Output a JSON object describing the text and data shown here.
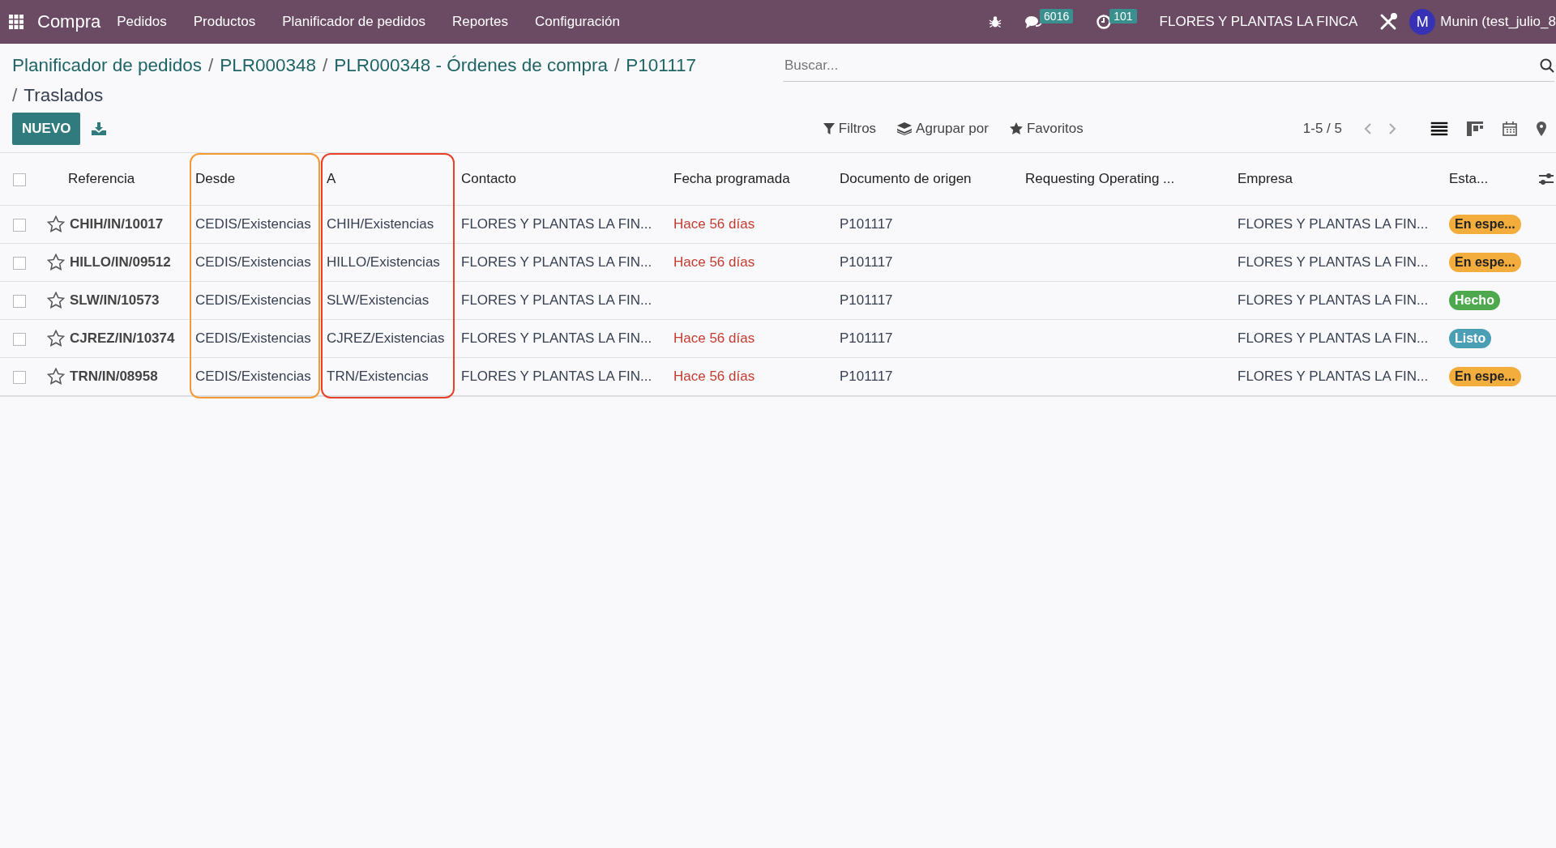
{
  "navbar": {
    "brand": "Compra",
    "menus": [
      "Pedidos",
      "Productos",
      "Planificador de pedidos",
      "Reportes",
      "Configuración"
    ],
    "messages_count": "6016",
    "activities_count": "101",
    "company": "FLORES Y PLANTAS LA FINCA",
    "avatar_letter": "M",
    "user": "Munin (test_julio_8"
  },
  "breadcrumbs": [
    {
      "label": "Planificador de pedidos"
    },
    {
      "separator": "/",
      "label": "PLR000348"
    },
    {
      "separator": "/",
      "label": "PLR000348 - Órdenes de compra"
    },
    {
      "separator": "/",
      "label": "P101117"
    },
    {
      "separator": "/",
      "label": "Traslados"
    }
  ],
  "search": {
    "placeholder": "Buscar..."
  },
  "buttons": {
    "new": "NUEVO"
  },
  "filters": [
    "Filtros",
    "Agrupar por",
    "Favoritos"
  ],
  "pager": "1-5 / 5",
  "views": [
    {
      "kind": "list",
      "selected": true
    },
    {
      "kind": "kanban",
      "selected": false
    },
    {
      "kind": "calendar",
      "selected": false
    },
    {
      "kind": "map",
      "selected": false
    }
  ],
  "table": {
    "select_all": {
      "checked": false
    },
    "columns": [
      {
        "label": "Referencia"
      },
      {
        "label": "Desde",
        "color": "#f39a35"
      },
      {
        "label": "A",
        "color": "#e8402a"
      },
      {
        "label": "Contacto"
      },
      {
        "label": "Fecha programada"
      },
      {
        "label": "Documento de origen"
      },
      {
        "label": "Requesting Operating ..."
      },
      {
        "label": "Empresa"
      },
      {
        "label": "Esta..."
      }
    ],
    "rows": [
      {
        "checked": false,
        "starred": false,
        "reference": "CHIH/IN/10017",
        "from": "CEDIS/Existencias",
        "to": "CHIH/Existencias",
        "contact": "FLORES Y PLANTAS LA FIN...",
        "scheduled_date": "Hace 56 días",
        "source_document": "P101117",
        "company": "FLORES Y PLANTAS LA FIN...",
        "status": {
          "label": "En espe...",
          "color": "#f3ad3d"
        }
      },
      {
        "checked": false,
        "starred": false,
        "reference": "HILLO/IN/09512",
        "from": "CEDIS/Existencias",
        "to": "HILLO/Existencias",
        "contact": "FLORES Y PLANTAS LA FIN...",
        "scheduled_date": "Hace 56 días",
        "source_document": "P101117",
        "company": "FLORES Y PLANTAS LA FIN...",
        "status": {
          "label": "En espe...",
          "color": "#f3ad3d"
        }
      },
      {
        "checked": false,
        "starred": false,
        "reference": "SLW/IN/10573",
        "from": "CEDIS/Existencias",
        "to": "SLW/Existencias",
        "contact": "FLORES Y PLANTAS LA FIN...",
        "source_document": "P101117",
        "company": "FLORES Y PLANTAS LA FIN...",
        "status": {
          "label": "Hecho",
          "color": "#4ea84e"
        }
      },
      {
        "checked": false,
        "starred": false,
        "reference": "CJREZ/IN/10374",
        "from": "CEDIS/Existencias",
        "to": "CJREZ/Existencias",
        "contact": "FLORES Y PLANTAS LA FIN...",
        "scheduled_date": "Hace 56 días",
        "source_document": "P101117",
        "company": "FLORES Y PLANTAS LA FIN...",
        "status": {
          "label": "Listo",
          "color": "#4a9fb5"
        }
      },
      {
        "checked": false,
        "starred": false,
        "reference": "TRN/IN/08958",
        "from": "CEDIS/Existencias",
        "to": "TRN/Existencias",
        "contact": "FLORES Y PLANTAS LA FIN...",
        "scheduled_date": "Hace 56 días",
        "source_document": "P101117",
        "company": "FLORES Y PLANTAS LA FIN...",
        "status": {
          "label": "En espe...",
          "color": "#f3ad3d"
        }
      }
    ]
  }
}
